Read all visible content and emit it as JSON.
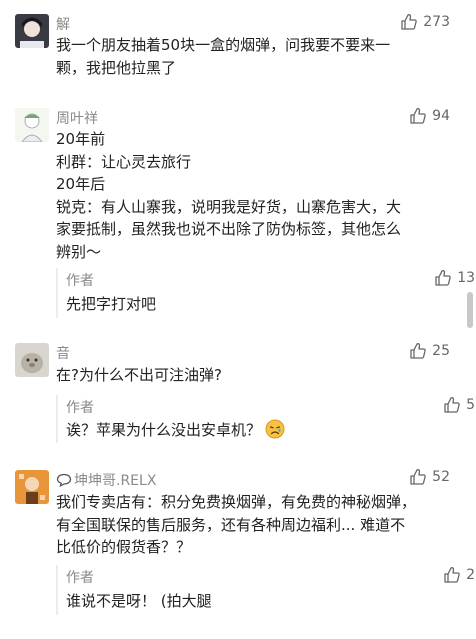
{
  "like_icon": "thumbs-up-outline-icon",
  "comments": [
    {
      "name": "解",
      "likes": "273",
      "text": [
        "我一个朋友抽着50块一盒的烟弹，问我要不要来一",
        "颗，我把他拉黑了"
      ]
    },
    {
      "name": "周叶祥",
      "likes": "94",
      "text": [
        "20年前",
        "利群：让心灵去旅行",
        "20年后",
        "锐克：有人山寨我，说明我是好货，山寨危害大，大",
        "家要抵制，虽然我也说不出除了防伪标签，其他怎么",
        "辨别～"
      ],
      "reply": {
        "name": "作者",
        "likes": "136",
        "text": "先把字打对吧"
      }
    },
    {
      "name": "音",
      "likes": "25",
      "text": [
        "在?为什么不出可注油弹?"
      ],
      "reply": {
        "name": "作者",
        "likes": "59",
        "text": "诶？苹果为什么没出安卓机？",
        "emoji": "sad-face-emoji"
      }
    },
    {
      "name": "坤坤哥.RELX",
      "name_icon": "chat-bubble-icon",
      "likes": "52",
      "text": [
        "我们专卖店有：积分免费换烟弹，有免费的神秘烟弹，",
        "有全国联保的售后服务，还有各种周边福利... 难道不",
        "比低价的假货香？？"
      ],
      "reply": {
        "name": "作者",
        "likes": "21",
        "text": "谁说不是呀！  (拍大腿"
      }
    }
  ]
}
